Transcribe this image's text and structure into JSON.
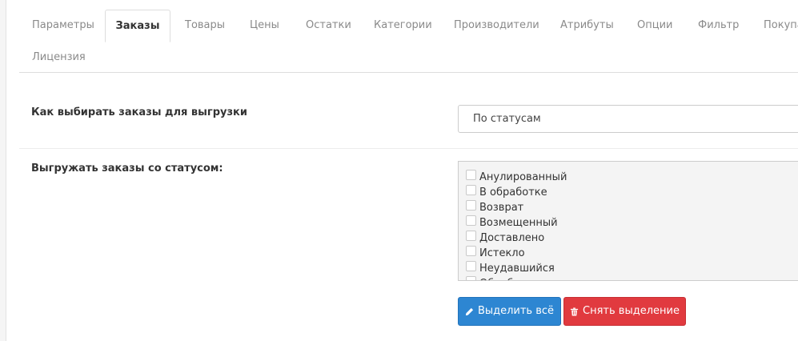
{
  "tabs": [
    {
      "label": "Параметры",
      "active": false
    },
    {
      "label": "Заказы",
      "active": true
    },
    {
      "label": "Товары",
      "active": false
    },
    {
      "label": "Цены",
      "active": false
    },
    {
      "label": "Остатки",
      "active": false
    },
    {
      "label": "Категории",
      "active": false
    },
    {
      "label": "Производители",
      "active": false
    },
    {
      "label": "Атрибуты",
      "active": false
    },
    {
      "label": "Опции",
      "active": false
    },
    {
      "label": "Фильтр",
      "active": false
    },
    {
      "label": "Покупа",
      "active": false
    },
    {
      "label": "Лицензия",
      "active": false
    }
  ],
  "form": {
    "select_mode_label": "Как выбирать заказы для выгрузки",
    "select_mode_value": "По статусам",
    "statuses_label": "Выгружать заказы со статусом:",
    "statuses": [
      {
        "label": "Анулированный",
        "checked": false
      },
      {
        "label": "В обработке",
        "checked": false
      },
      {
        "label": "Возврат",
        "checked": false
      },
      {
        "label": "Возмещенный",
        "checked": false
      },
      {
        "label": "Доставлено",
        "checked": false
      },
      {
        "label": "Истекло",
        "checked": false
      },
      {
        "label": "Неудавшийся",
        "checked": false
      },
      {
        "label": "Обработка",
        "checked": false
      }
    ]
  },
  "buttons": {
    "select_all": {
      "label": "Выделить всё",
      "icon": "pencil-icon",
      "color": "#2d86d2"
    },
    "deselect": {
      "label": "Снять выделение",
      "icon": "trash-icon",
      "color": "#e13a3f"
    }
  }
}
